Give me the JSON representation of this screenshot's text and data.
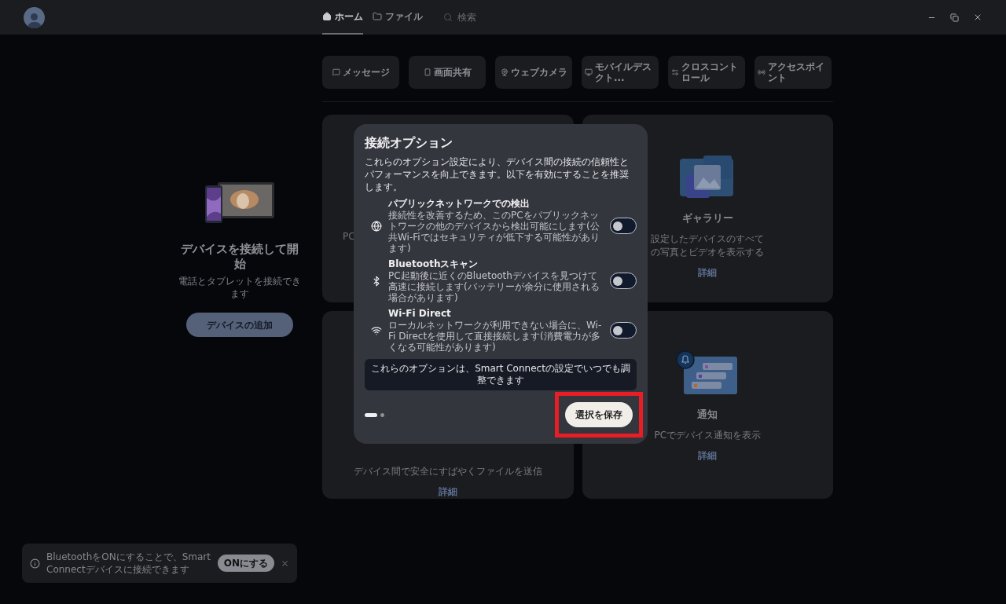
{
  "header": {
    "tabs": [
      {
        "label": "ホーム",
        "selected": true
      },
      {
        "label": "ファイル",
        "selected": false
      }
    ],
    "search": {
      "placeholder": "検索"
    }
  },
  "sidebar": {
    "title": "デバイスを接続して開始",
    "subtitle": "電話とタブレットを接続できます",
    "button": "デバイスの追加"
  },
  "quick_actions": [
    {
      "label": "メッセージ"
    },
    {
      "label": "画面共有"
    },
    {
      "label": "ウェブカメラ"
    },
    {
      "label": "モバイルデスクト..."
    },
    {
      "label": "クロスコントロール"
    },
    {
      "label": "アクセスポイント"
    }
  ],
  "cards": [
    {
      "description": "PC"
    },
    {
      "title": "ギャラリー",
      "description": "設定したデバイスのすべての写真とビデオを表示する",
      "link": "詳細"
    },
    {
      "description": "デバイス間で安全にすばやくファイルを送信",
      "link": "詳細"
    },
    {
      "title": "通知",
      "description": "PCでデバイス通知を表示",
      "link": "詳細"
    }
  ],
  "modal": {
    "title": "接続オプション",
    "description": "これらのオプション設定により、デバイス間の接続の信頼性とパフォーマンスを向上できます。以下を有効にすることを推奨します。",
    "options": [
      {
        "title": "パブリックネットワークでの検出",
        "description": "接続性を改善するため、このPCをパブリックネットワークの他のデバイスから検出可能にします(公共Wi-Fiではセキュリティが低下する可能性があります)",
        "on": false
      },
      {
        "title": "Bluetoothスキャン",
        "description": "PC起動後に近くのBluetoothデバイスを見つけて高速に接続します(バッテリーが余分に使用される場合があります)",
        "on": false
      },
      {
        "title": "Wi-Fi Direct",
        "description": "ローカルネットワークが利用できない場合に、Wi-Fi Directを使用して直接接続します(消費電力が多くなる可能性があります)",
        "on": false
      }
    ],
    "note": "これらのオプションは、Smart Connectの設定でいつでも調整できます",
    "pages": [
      {
        "selected": true
      },
      {
        "selected": false
      }
    ],
    "save_button": "選択を保存",
    "save_highlighted": true
  },
  "toast": {
    "message": "BluetoothをONにすることで、Smart Connectデバイスに接続できます",
    "button": "ONにする"
  }
}
